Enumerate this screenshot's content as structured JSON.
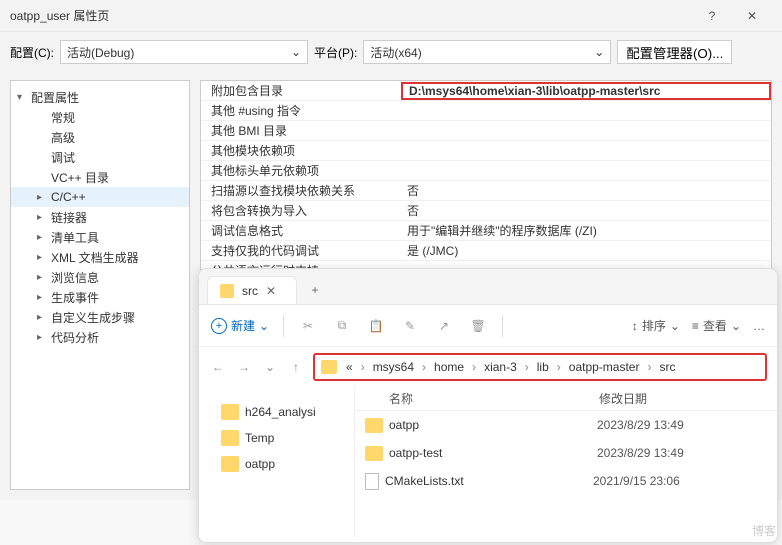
{
  "dialog": {
    "title": "oatpp_user 属性页",
    "help_icon": "?",
    "close_icon": "✕",
    "config_label": "配置(C):",
    "config_value": "活动(Debug)",
    "platform_label": "平台(P):",
    "platform_value": "活动(x64)",
    "manager_button": "配置管理器(O)..."
  },
  "tree": [
    {
      "label": "配置属性",
      "level": 1,
      "expanded": true
    },
    {
      "label": "常规",
      "level": 2,
      "leaf": true
    },
    {
      "label": "高级",
      "level": 2,
      "leaf": true
    },
    {
      "label": "调试",
      "level": 2,
      "leaf": true
    },
    {
      "label": "VC++ 目录",
      "level": 2,
      "leaf": true
    },
    {
      "label": "C/C++",
      "level": 2,
      "expanded": false,
      "selected": true
    },
    {
      "label": "链接器",
      "level": 2,
      "expanded": false
    },
    {
      "label": "清单工具",
      "level": 2,
      "expanded": false
    },
    {
      "label": "XML 文档生成器",
      "level": 2,
      "expanded": false
    },
    {
      "label": "浏览信息",
      "level": 2,
      "expanded": false
    },
    {
      "label": "生成事件",
      "level": 2,
      "expanded": false
    },
    {
      "label": "自定义生成步骤",
      "level": 2,
      "expanded": false
    },
    {
      "label": "代码分析",
      "level": 2,
      "expanded": false
    }
  ],
  "props": [
    {
      "k": "附加包含目录",
      "v": "D:\\msys64\\home\\xian-3\\lib\\oatpp-master\\src",
      "highlight": true
    },
    {
      "k": "其他 #using 指令",
      "v": ""
    },
    {
      "k": "其他 BMI 目录",
      "v": ""
    },
    {
      "k": "其他模块依赖项",
      "v": ""
    },
    {
      "k": "其他标头单元依赖项",
      "v": ""
    },
    {
      "k": "扫描源以查找模块依赖关系",
      "v": "否"
    },
    {
      "k": "将包含转换为导入",
      "v": "否"
    },
    {
      "k": "调试信息格式",
      "v": "用于\"编辑并继续\"的程序数据库 (/ZI)"
    },
    {
      "k": "支持仅我的代码调试",
      "v": "是 (/JMC)"
    },
    {
      "k": "公共语言运行时支持",
      "v": ""
    }
  ],
  "explorer": {
    "tab_title": "src",
    "new_label": "新建",
    "sort_label": "排序",
    "view_label": "查看",
    "more": "…",
    "crumbs": [
      "msys64",
      "home",
      "xian-3",
      "lib",
      "oatpp-master",
      "src"
    ],
    "crumb_prefix": "«",
    "side_items": [
      "h264_analysi",
      "Temp",
      "oatpp"
    ],
    "columns": {
      "name": "名称",
      "modified": "修改日期"
    },
    "files": [
      {
        "name": "oatpp",
        "type": "folder",
        "date": "2023/8/29 13:49"
      },
      {
        "name": "oatpp-test",
        "type": "folder",
        "date": "2023/8/29 13:49"
      },
      {
        "name": "CMakeLists.txt",
        "type": "file",
        "date": "2021/9/15 23:06"
      }
    ]
  },
  "watermark": "博客"
}
